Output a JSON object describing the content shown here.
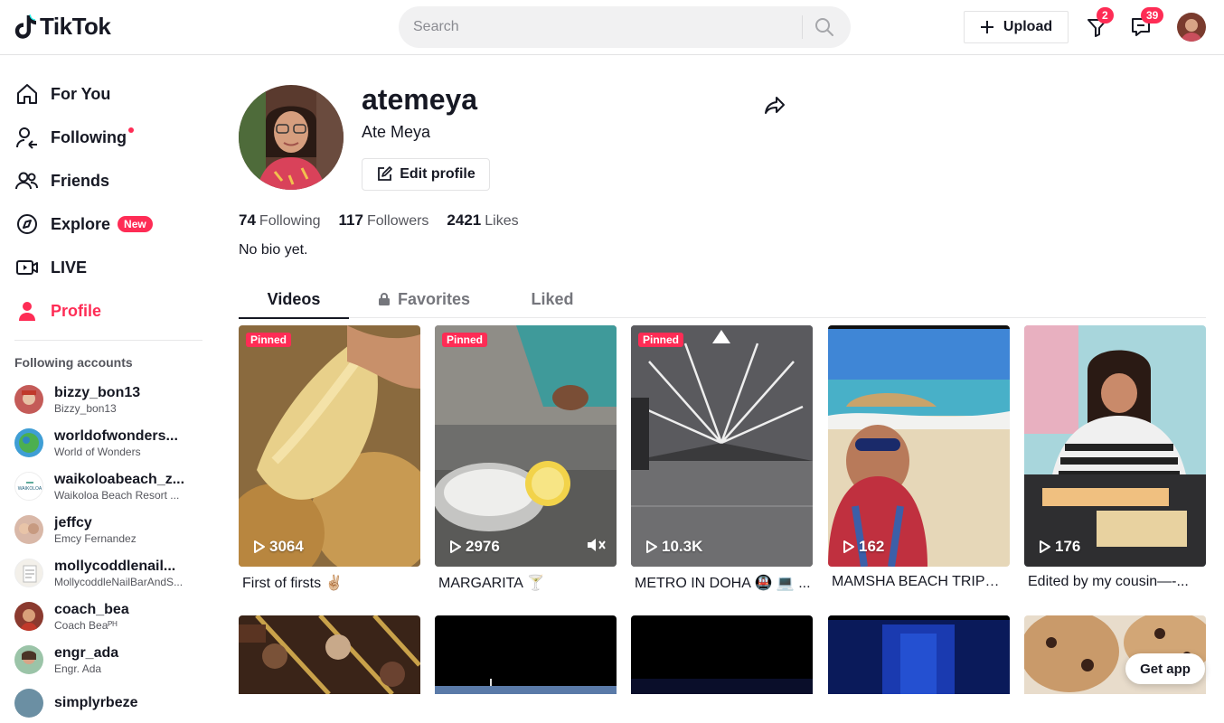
{
  "header": {
    "logo_text": "TikTok",
    "search_placeholder": "Search",
    "upload_label": "Upload",
    "inbox_badge": "2",
    "messages_badge": "39"
  },
  "sidebar": {
    "nav": [
      {
        "label": "For You",
        "icon": "home-icon"
      },
      {
        "label": "Following",
        "icon": "following-icon"
      },
      {
        "label": "Friends",
        "icon": "friends-icon"
      },
      {
        "label": "Explore",
        "icon": "compass-icon",
        "badge": "New"
      },
      {
        "label": "LIVE",
        "icon": "live-icon"
      },
      {
        "label": "Profile",
        "icon": "profile-icon"
      }
    ],
    "following_title": "Following accounts",
    "accounts": [
      {
        "username": "bizzy_bon13",
        "name": "Bizzy_bon13"
      },
      {
        "username": "worldofwonders...",
        "name": "World of Wonders"
      },
      {
        "username": "waikoloabeach_z...",
        "name": "Waikoloa Beach Resort ..."
      },
      {
        "username": "jeffcy",
        "name": "Emcy Fernandez"
      },
      {
        "username": "mollycoddlenail...",
        "name": "MollycoddleNailBarAndS..."
      },
      {
        "username": "coach_bea",
        "name": "Coach Beaᴾᴴ"
      },
      {
        "username": "engr_ada",
        "name": "Engr. Ada"
      },
      {
        "username": "simplyrbeze",
        "name": ""
      }
    ]
  },
  "profile": {
    "username": "atemeya",
    "nickname": "Ate Meya",
    "edit_label": "Edit profile",
    "following_count": "74",
    "following_label": "Following",
    "followers_count": "117",
    "followers_label": "Followers",
    "likes_count": "2421",
    "likes_label": "Likes",
    "bio": "No bio yet."
  },
  "tabs": [
    "Videos",
    "Favorites",
    "Liked"
  ],
  "videos": [
    {
      "views": "3064",
      "caption": "First of firsts ✌🏼",
      "pinned": "Pinned"
    },
    {
      "views": "2976",
      "caption": "MARGARITA 🍸",
      "pinned": "Pinned"
    },
    {
      "views": "10.3K",
      "caption": "METRO IN DOHA 🚇 💻 ...",
      "pinned": "Pinned"
    },
    {
      "views": "162",
      "caption": "MAMSHA BEACH TRIPPI..."
    },
    {
      "views": "176",
      "caption": "Edited by my cousin—-..."
    }
  ],
  "get_app_label": "Get app",
  "colors": {
    "accent": "#fe2c55",
    "text": "#161823"
  }
}
